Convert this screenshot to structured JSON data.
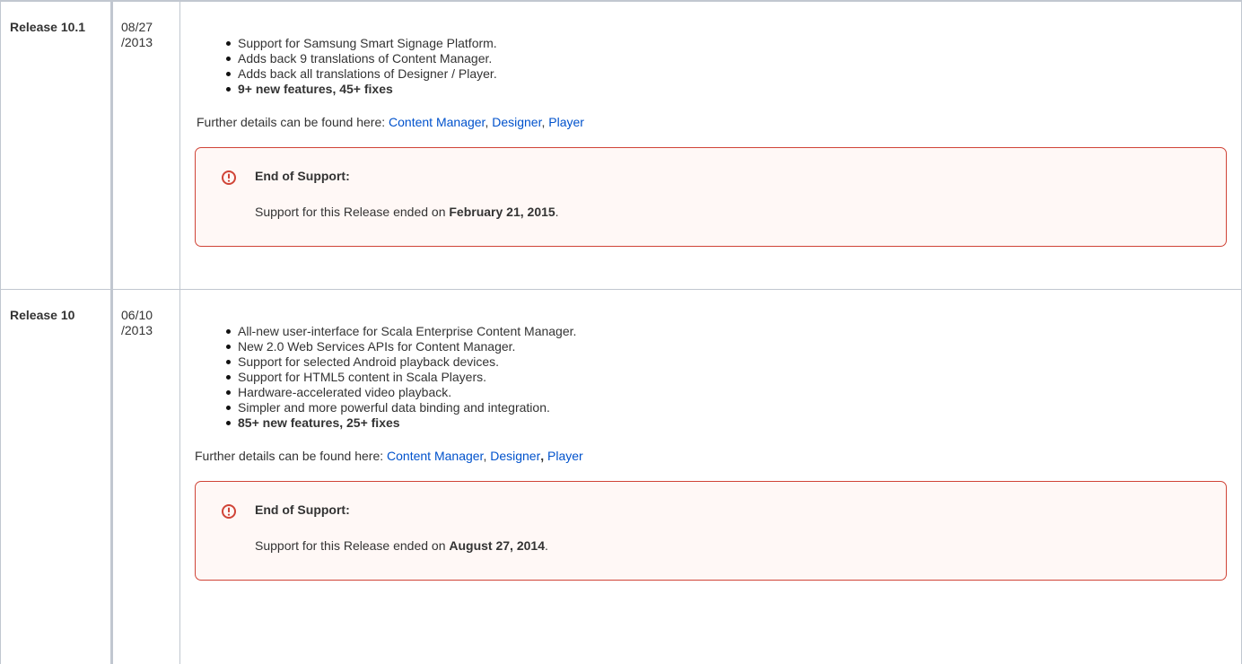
{
  "releases": [
    {
      "name": "Release 10.1",
      "date": "08/27 /2013",
      "features": [
        "Support for Samsung Smart Signage Platform.",
        "Adds back 9 translations of Content Manager.",
        "Adds back all translations of Designer / Player.",
        "9+ new features, 45+ fixes"
      ],
      "details_prefix": "Further details can be found here: ",
      "links": [
        "Content Manager",
        "Designer",
        "Player"
      ],
      "separators": [
        ", ",
        ", "
      ],
      "panel": {
        "title": "End of Support:",
        "body_prefix": "Support for this Release ended on ",
        "body_date": "February 21, 2015",
        "body_suffix": "."
      }
    },
    {
      "name": "Release 10",
      "date": "06/10 /2013",
      "features": [
        "All-new user-interface for Scala Enterprise Content Manager.",
        "New 2.0 Web Services APIs for Content Manager.",
        "Support for selected Android playback devices.",
        "Support for HTML5 content in Scala Players.",
        "Hardware-accelerated video playback.",
        "Simpler and more powerful data binding and integration.",
        "85+ new features, 25+ fixes"
      ],
      "details_prefix": "Further details can be found here: ",
      "links": [
        "Content Manager",
        "Designer",
        "Player"
      ],
      "separators": [
        ", ",
        ", "
      ],
      "panel": {
        "title": "End of Support:",
        "body_prefix": "Support for this Release ended on ",
        "body_date": "August 27, 2014",
        "body_suffix": "."
      }
    }
  ],
  "colors": {
    "link": "#0052cc",
    "panel_border": "#d04437",
    "panel_background": "#fff8f6",
    "table_border": "#c1c7d0"
  },
  "icons": {
    "panel_icon": "exclamation-circle-icon"
  }
}
